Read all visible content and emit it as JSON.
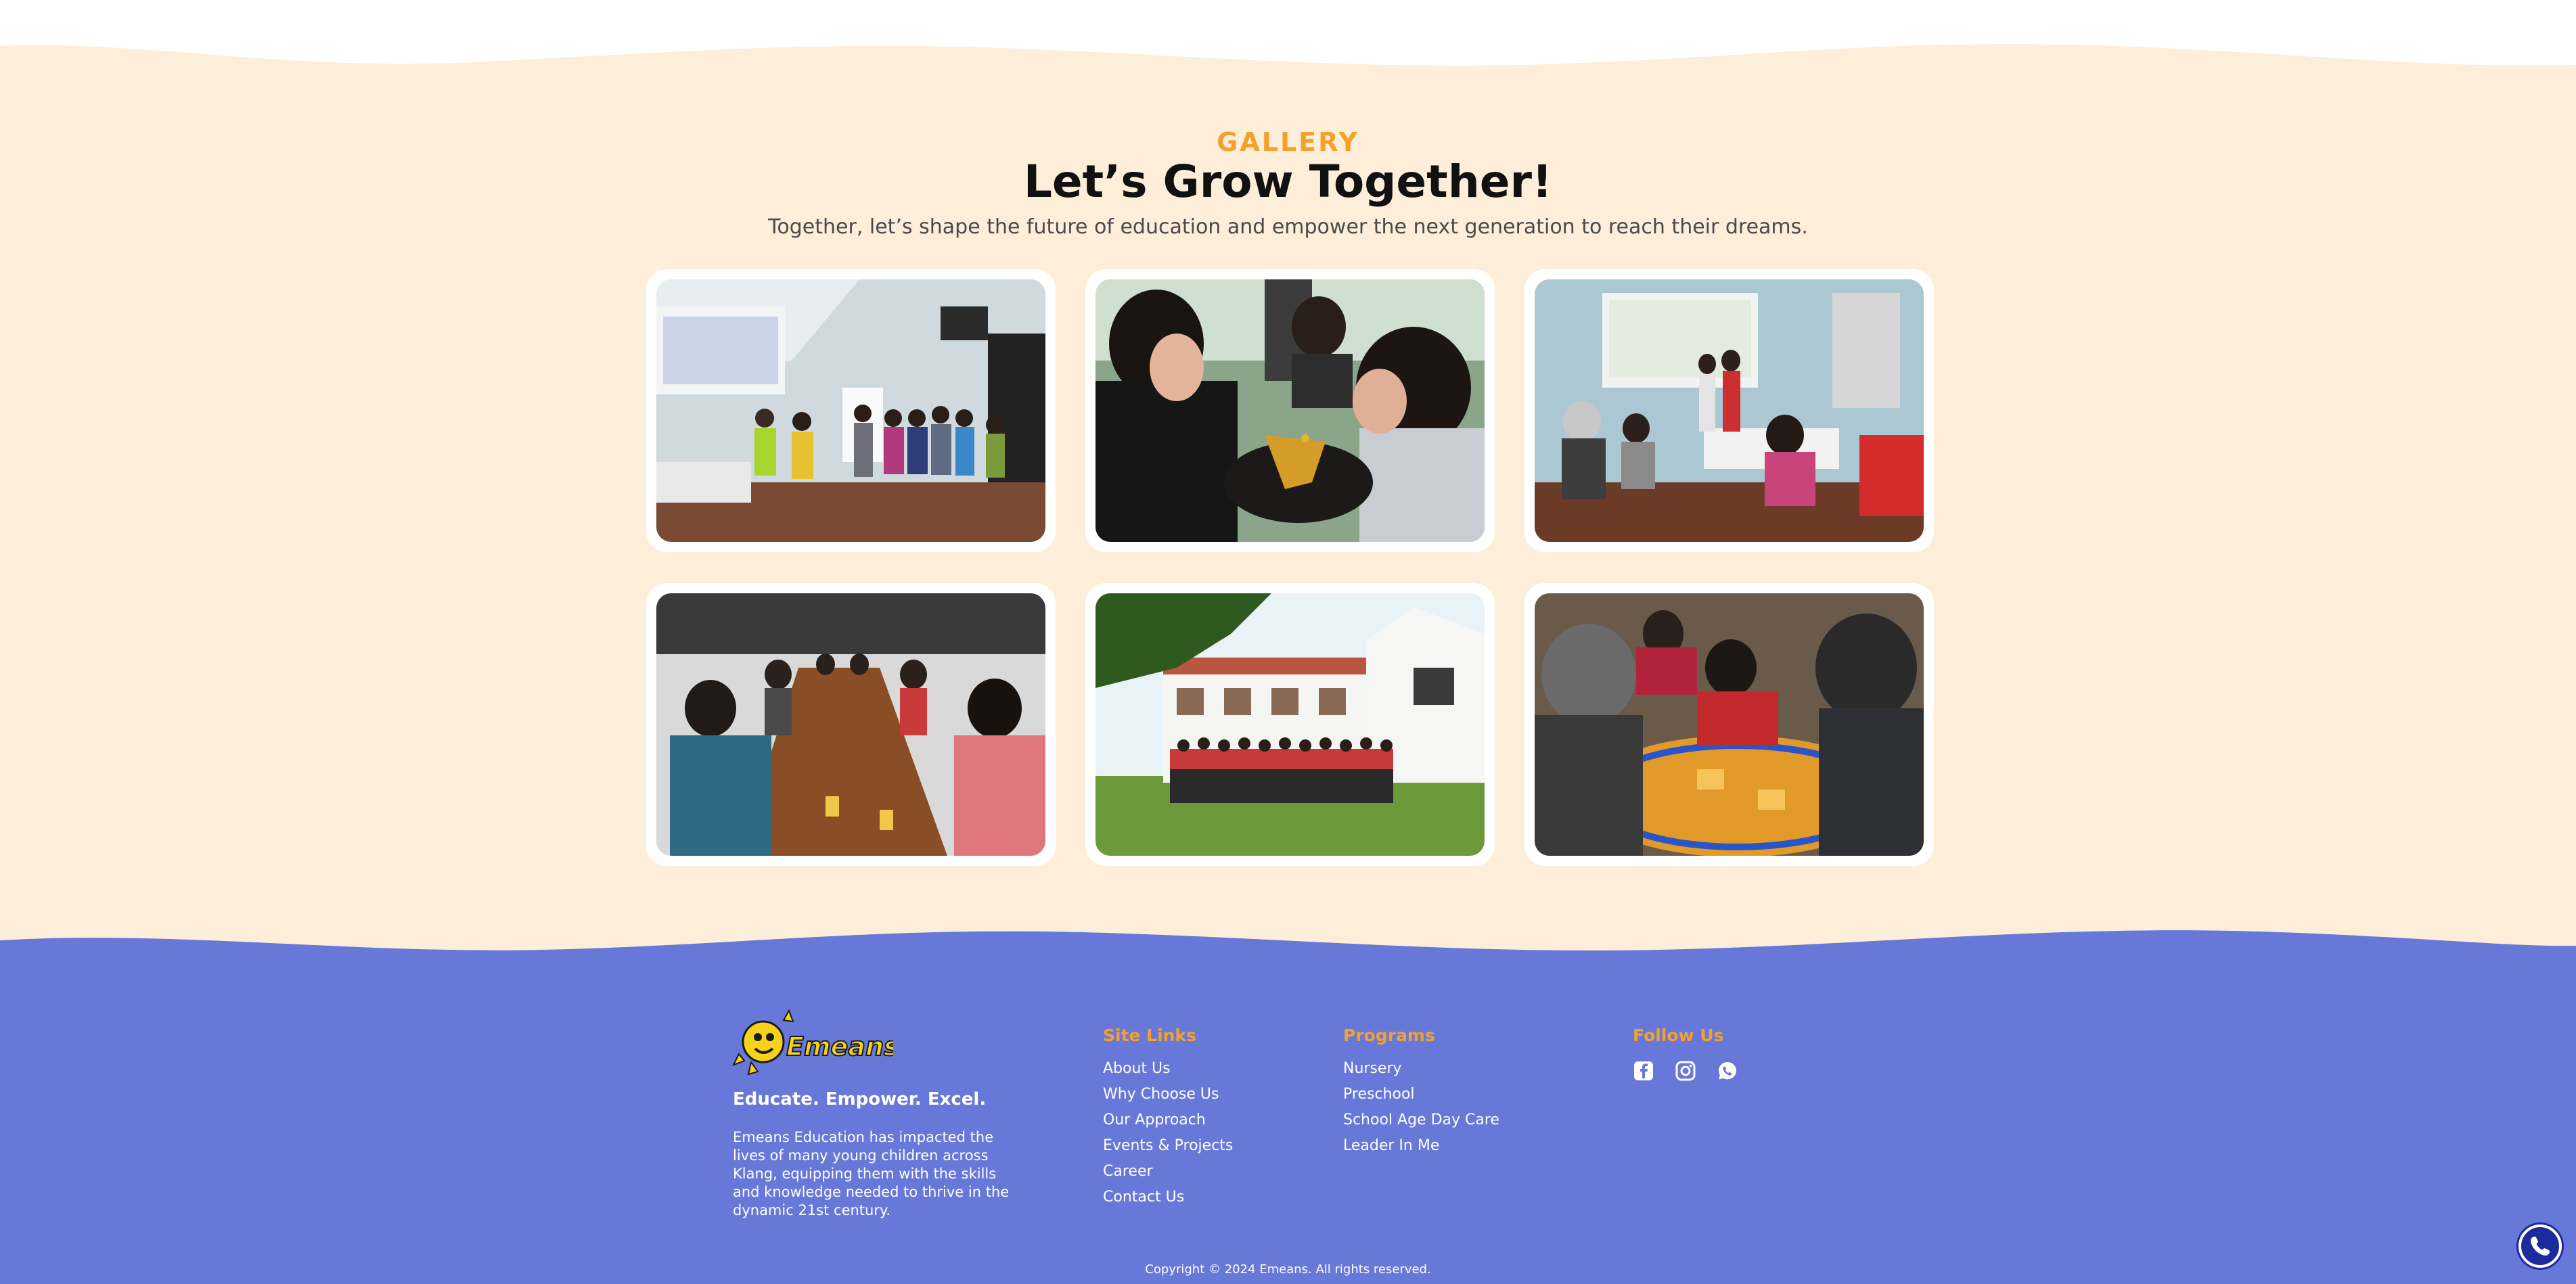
{
  "gallery": {
    "eyebrow": "GALLERY",
    "title": "Let’s Grow Together!",
    "subtitle": "Together, let’s shape the future of education and empower the next generation to reach their dreams."
  },
  "footer": {
    "brand": {
      "logo_text": "Emeans",
      "tagline": "Educate. Empower. Excel.",
      "description": "Emeans Education has impacted the lives of many young children across Klang, equipping them with the skills and knowledge needed to thrive in the dynamic 21st century."
    },
    "site_links": {
      "heading": "Site Links",
      "items": [
        "About Us",
        "Why Choose Us",
        "Our Approach",
        "Events & Projects",
        "Career",
        "Contact Us"
      ]
    },
    "programs": {
      "heading": "Programs",
      "items": [
        "Nursery",
        "Preschool",
        "School Age Day Care",
        "Leader In Me"
      ]
    },
    "follow": {
      "heading": "Follow Us",
      "icons": [
        "facebook-icon",
        "instagram-icon",
        "whatsapp-icon"
      ]
    },
    "copyright": "Copyright © 2024 Emeans. All rights reserved."
  },
  "colors": {
    "gallery_bg": "#fdeed9",
    "footer_bg": "#6878d8",
    "accent": "#f4a12c",
    "call_button": "#1c2a9e"
  }
}
